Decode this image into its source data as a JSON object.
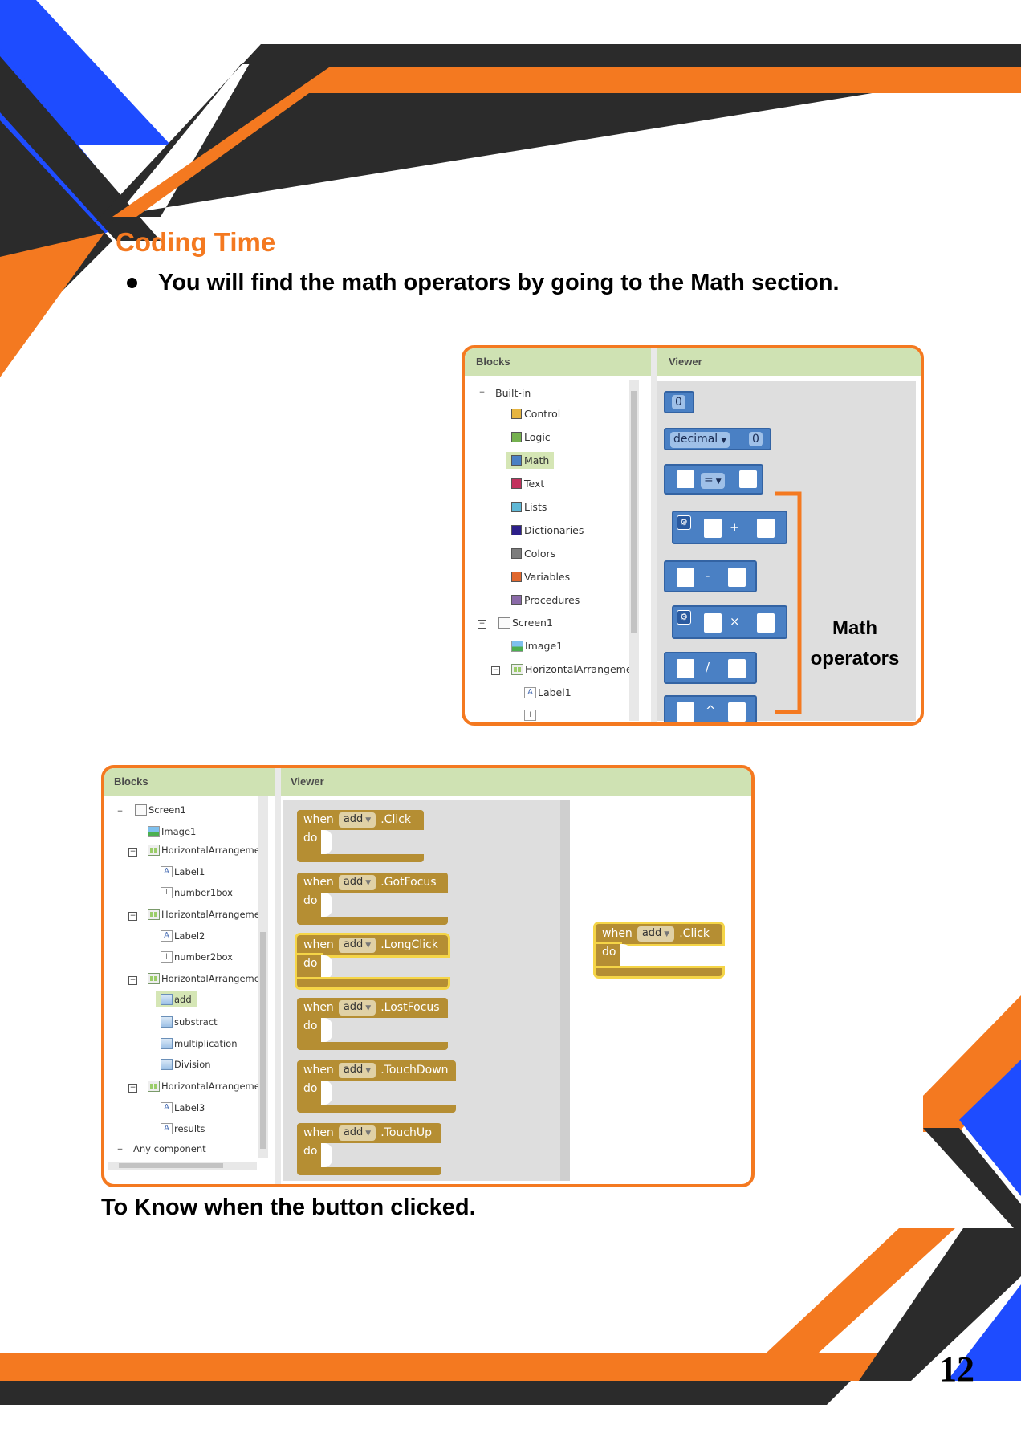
{
  "page": {
    "heading": "Coding Time",
    "bullet": "You will find the math operators by going to the Math section.",
    "caption": "To Know when the button clicked.",
    "page_number": "12"
  },
  "colors": {
    "orange": "#f47920",
    "blue": "#1e4cff",
    "dark": "#2b2b2b",
    "header_green": "#cfe2b3",
    "math_blue": "#4a80c4",
    "event_gold": "#b58e33"
  },
  "panel1": {
    "blocks_title": "Blocks",
    "viewer_title": "Viewer",
    "tree": {
      "builtin": "Built-in",
      "control": "Control",
      "logic": "Logic",
      "math": "Math",
      "text": "Text",
      "lists": "Lists",
      "dictionaries": "Dictionaries",
      "colors": "Colors",
      "variables": "Variables",
      "procedures": "Procedures",
      "screen1": "Screen1",
      "image1": "Image1",
      "harr": "HorizontalArrangemer",
      "label1": "Label1"
    },
    "blocks": {
      "zero": "0",
      "decimal": "decimal",
      "decimal_value": "0",
      "eq": "=",
      "plus": "+",
      "minus": "-",
      "times": "×",
      "divide": "/",
      "power": "^"
    },
    "annotation_line1": "Math",
    "annotation_line2": "operators"
  },
  "panel2": {
    "blocks_title": "Blocks",
    "viewer_title": "Viewer",
    "tree": {
      "screen1": "Screen1",
      "image1": "Image1",
      "harr1": "HorizontalArrangemer",
      "label1": "Label1",
      "number1box": "number1box",
      "harr2": "HorizontalArrangemer",
      "label2": "Label2",
      "number2box": "number2box",
      "harr3": "HorizontalArrangemer",
      "add": "add",
      "substract": "substract",
      "multiplication": "multiplication",
      "division": "Division",
      "harr4": "HorizontalArrangemer",
      "label3": "Label3",
      "results": "results",
      "any": "Any component"
    },
    "when": "when",
    "do": "do",
    "component": "add",
    "events": [
      ".Click",
      ".GotFocus",
      ".LongClick",
      ".LostFocus",
      ".TouchDown",
      ".TouchUp"
    ],
    "dropped_event": ".Click"
  }
}
